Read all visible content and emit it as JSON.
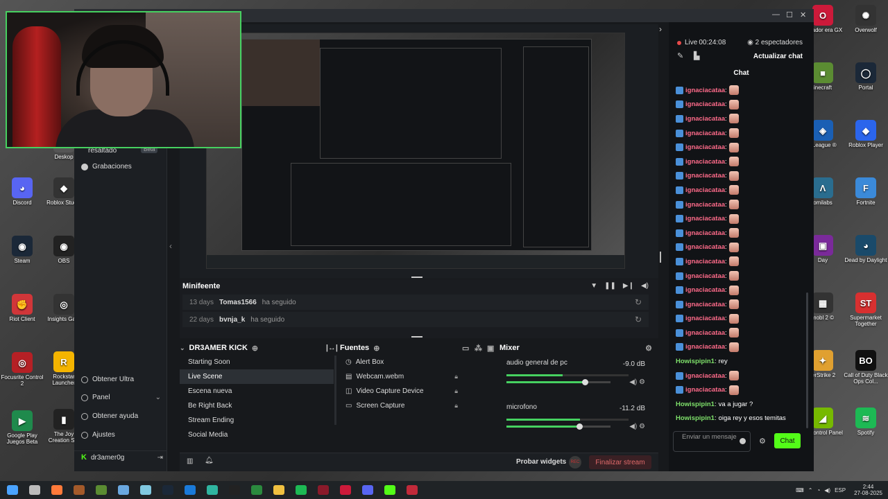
{
  "desktop": {
    "icons_left": [
      {
        "label": "Discord",
        "color": "#5865f2",
        "glyph": "◕"
      },
      {
        "label": "Steam",
        "color": "#1b2838",
        "glyph": "◉"
      },
      {
        "label": "Riot Client",
        "color": "#d13639",
        "glyph": "✊"
      },
      {
        "label": "Focusrite Control 2",
        "color": "#b52025",
        "glyph": "◎"
      },
      {
        "label": "Google Play Juegos Beta",
        "color": "#1f8a4c",
        "glyph": "▶"
      }
    ],
    "icons_left2": [
      {
        "label": "Deskop",
        "color": "#555555",
        "glyph": ""
      },
      {
        "label": "Roblox Studio",
        "color": "#333333",
        "glyph": "◆"
      },
      {
        "label": "OBS",
        "color": "#222222",
        "glyph": "◉"
      },
      {
        "label": "Insights Ga...",
        "color": "#333333",
        "glyph": "◎"
      },
      {
        "label": "Rockstar Launcher",
        "color": "#f4b400",
        "glyph": "R"
      },
      {
        "label": "The Joy Creation S...",
        "color": "#222222",
        "glyph": "▮"
      }
    ],
    "icons_right1": [
      {
        "label": "vegador era GX",
        "color": "#cc1a3a",
        "glyph": "O"
      },
      {
        "label": "inecraft",
        "color": "#5b8c32",
        "glyph": "■"
      },
      {
        "label": "t League ®",
        "color": "#1a5fb4",
        "glyph": "◈"
      },
      {
        "label": "omilabs",
        "color": "#2a6d8f",
        "glyph": "Λ"
      },
      {
        "label": "Day",
        "color": "#7a2a9a",
        "glyph": "▣"
      },
      {
        "label": "mobl 2 ©",
        "color": "#333333",
        "glyph": "▦"
      },
      {
        "label": "terStrike 2",
        "color": "#e0a030",
        "glyph": "✦"
      },
      {
        "label": "IA Control Panel",
        "color": "#76b900",
        "glyph": "◢"
      }
    ],
    "icons_right2": [
      {
        "label": "Overwolf",
        "color": "#333333",
        "glyph": "✺"
      },
      {
        "label": "Portal",
        "color": "#1b2838",
        "glyph": "◯"
      },
      {
        "label": "Roblox Player",
        "color": "#2b65ec",
        "glyph": "◆"
      },
      {
        "label": "Fortnite",
        "color": "#3b8ad9",
        "glyph": "F"
      },
      {
        "label": "Dead by Daylight",
        "color": "#1a4a6a",
        "glyph": "◕"
      },
      {
        "label": "Supermarket Together",
        "color": "#d83030",
        "glyph": "ST"
      },
      {
        "label": "Call of Duty Black Ops Col...",
        "color": "#111111",
        "glyph": "BO"
      },
      {
        "label": "Spotify",
        "color": "#1db954",
        "glyph": "≋"
      }
    ]
  },
  "sidebar": {
    "items_top": [
      {
        "label": "resaltado",
        "badge": "Beta"
      },
      {
        "label": "Grabaciones"
      }
    ],
    "items_bottom": [
      {
        "label": "Obtener Ultra"
      },
      {
        "label": "Panel"
      },
      {
        "label": "Obtener ayuda"
      },
      {
        "label": "Ajustes"
      }
    ],
    "user": "dr3amer0g"
  },
  "minifeed": {
    "title": "Minifeente",
    "rows": [
      {
        "days": "13 days",
        "user": "Tomas1566",
        "action": "ha seguido"
      },
      {
        "days": "22 days",
        "user": "bvnja_k",
        "action": "ha seguido"
      }
    ]
  },
  "scenes": {
    "title": "DR3AMER KICK",
    "items": [
      "Starting Soon",
      "Live Scene",
      "Escena nueva",
      "Be Right Back",
      "Stream Ending",
      "Social Media"
    ],
    "active": 1
  },
  "sources": {
    "title": "Fuentes",
    "items": [
      "Alert Box",
      "Webcam.webm",
      "Video Capture Device",
      "Screen Capture"
    ]
  },
  "mixer": {
    "title": "Mixer",
    "channels": [
      {
        "name": "audio general de pc",
        "db": "-9.0 dB",
        "meter": 0.46,
        "volume": 0.75
      },
      {
        "name": "microfono",
        "db": "-11.2 dB",
        "meter": 0.6,
        "volume": 0.7
      }
    ]
  },
  "bottombar": {
    "test_widgets": "Probar widgets",
    "rec": "REC",
    "end_stream": "Finalizar stream"
  },
  "chat": {
    "live_label": "Live",
    "live_time": "00:24:08",
    "viewers": "2 espectadores",
    "refresh": "Actualizar chat",
    "title": "Chat",
    "messages": [
      {
        "user": "ignaciacataa",
        "color": "#ff6b8a",
        "text": "",
        "emote": true
      },
      {
        "user": "ignaciacataa",
        "color": "#ff6b8a",
        "text": "",
        "emote": true
      },
      {
        "user": "ignaciacataa",
        "color": "#ff6b8a",
        "text": "",
        "emote": true
      },
      {
        "user": "ignaciacataa",
        "color": "#ff6b8a",
        "text": "",
        "emote": true
      },
      {
        "user": "ignaciacataa",
        "color": "#ff6b8a",
        "text": "",
        "emote": true
      },
      {
        "user": "ignaciacataa",
        "color": "#ff6b8a",
        "text": "",
        "emote": true
      },
      {
        "user": "ignaciacataa",
        "color": "#ff6b8a",
        "text": "",
        "emote": true
      },
      {
        "user": "ignaciacataa",
        "color": "#ff6b8a",
        "text": "",
        "emote": true
      },
      {
        "user": "ignaciacataa",
        "color": "#ff6b8a",
        "text": "",
        "emote": true
      },
      {
        "user": "ignaciacataa",
        "color": "#ff6b8a",
        "text": "",
        "emote": true
      },
      {
        "user": "ignaciacataa",
        "color": "#ff6b8a",
        "text": "",
        "emote": true
      },
      {
        "user": "ignaciacataa",
        "color": "#ff6b8a",
        "text": "",
        "emote": true
      },
      {
        "user": "ignaciacataa",
        "color": "#ff6b8a",
        "text": "",
        "emote": true
      },
      {
        "user": "ignaciacataa",
        "color": "#ff6b8a",
        "text": "",
        "emote": true
      },
      {
        "user": "ignaciacataa",
        "color": "#ff6b8a",
        "text": "",
        "emote": true
      },
      {
        "user": "ignaciacataa",
        "color": "#ff6b8a",
        "text": "",
        "emote": true
      },
      {
        "user": "ignaciacataa",
        "color": "#ff6b8a",
        "text": "",
        "emote": true
      },
      {
        "user": "ignaciacataa",
        "color": "#ff6b8a",
        "text": "",
        "emote": true
      },
      {
        "user": "ignaciacataa",
        "color": "#ff6b8a",
        "text": "",
        "emote": true
      },
      {
        "user": "Howispipin1",
        "color": "#7ee06a",
        "text": "rey",
        "emote": false
      },
      {
        "user": "ignaciacataa",
        "color": "#ff6b8a",
        "text": "",
        "emote": true
      },
      {
        "user": "ignaciacataa",
        "color": "#ff6b8a",
        "text": "",
        "emote": true
      },
      {
        "user": "Howispipin1",
        "color": "#7ee06a",
        "text": "va a jugar ?",
        "emote": false
      },
      {
        "user": "Howispipin1",
        "color": "#7ee06a",
        "text": "oiga rey y esos temitas",
        "emote": false
      }
    ],
    "input_placeholder": "Enviar un mensaje",
    "send": "Chat"
  },
  "taskbar": {
    "apps": [
      {
        "name": "windows-icon",
        "color": "#4aa3ff"
      },
      {
        "name": "taskview-icon",
        "color": "#bbbbbb"
      },
      {
        "name": "paint-icon",
        "color": "#ff7a3a"
      },
      {
        "name": "app-icon",
        "color": "#a35a2a"
      },
      {
        "name": "minecraft-icon",
        "color": "#5b8c32"
      },
      {
        "name": "app-icon",
        "color": "#6aa8e0"
      },
      {
        "name": "app-icon",
        "color": "#80c8e0"
      },
      {
        "name": "steam-icon",
        "color": "#1b2838"
      },
      {
        "name": "app-icon",
        "color": "#1a7ad9"
      },
      {
        "name": "edge-icon",
        "color": "#2fb5a0"
      },
      {
        "name": "epic-icon",
        "color": "#222222"
      },
      {
        "name": "xbox-icon",
        "color": "#2b8a3e"
      },
      {
        "name": "folder-icon",
        "color": "#f0c040"
      },
      {
        "name": "spotify-icon",
        "color": "#1db954"
      },
      {
        "name": "app-icon",
        "color": "#8a1a2a"
      },
      {
        "name": "opera-icon",
        "color": "#cc1a3a"
      },
      {
        "name": "discord-icon",
        "color": "#5865f2"
      },
      {
        "name": "kick-icon",
        "color": "#53fc18"
      },
      {
        "name": "app-icon",
        "color": "#c22a3a"
      }
    ],
    "lang": "ESP",
    "time": "2:44",
    "date": "27-08-2025"
  }
}
